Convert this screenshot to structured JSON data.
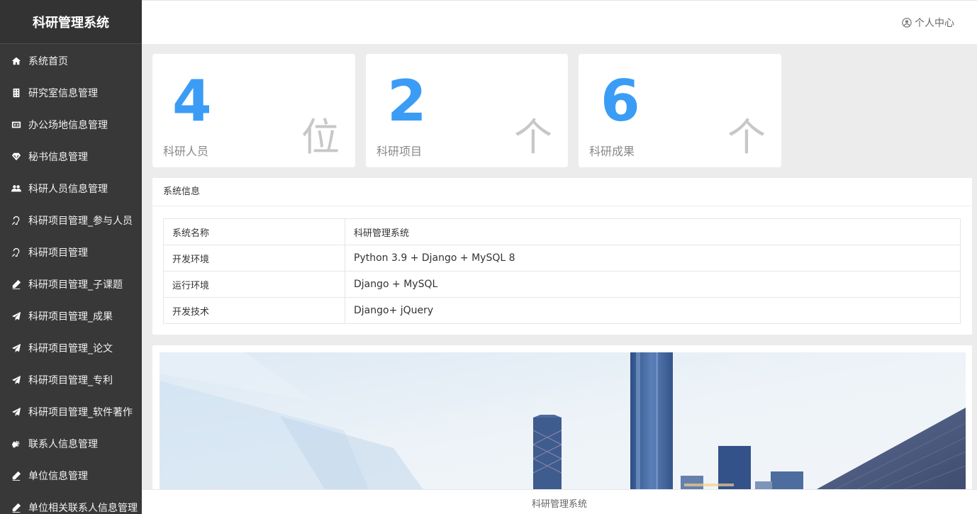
{
  "app": {
    "title": "科研管理系统"
  },
  "sidebar": {
    "items": [
      {
        "label": "系统首页",
        "icon": "home-icon"
      },
      {
        "label": "研究室信息管理",
        "icon": "building-icon"
      },
      {
        "label": "办公场地信息管理",
        "icon": "cc-icon"
      },
      {
        "label": "秘书信息管理",
        "icon": "diamond-icon"
      },
      {
        "label": "科研人员信息管理",
        "icon": "users-icon"
      },
      {
        "label": "科研项目管理_参与人员",
        "icon": "hearing-icon"
      },
      {
        "label": "科研项目管理",
        "icon": "hearing-icon"
      },
      {
        "label": "科研项目管理_子课题",
        "icon": "pencil-icon"
      },
      {
        "label": "科研项目管理_成果",
        "icon": "paper-plane-icon"
      },
      {
        "label": "科研项目管理_论文",
        "icon": "paper-plane-icon"
      },
      {
        "label": "科研项目管理_专利",
        "icon": "paper-plane-icon"
      },
      {
        "label": "科研项目管理_软件著作",
        "icon": "paper-plane-icon"
      },
      {
        "label": "联系人信息管理",
        "icon": "sign-language-icon"
      },
      {
        "label": "单位信息管理",
        "icon": "pencil-icon"
      },
      {
        "label": "单位相关联系人信息管理",
        "icon": "pencil-icon"
      }
    ]
  },
  "header": {
    "user_center": "个人中心"
  },
  "stats": [
    {
      "value": "4",
      "label": "科研人员",
      "unit": "位"
    },
    {
      "value": "2",
      "label": "科研项目",
      "unit": "个"
    },
    {
      "value": "6",
      "label": "科研成果",
      "unit": "个"
    }
  ],
  "system_info": {
    "title": "系统信息",
    "rows": [
      {
        "key": "系统名称",
        "value": "科研管理系统"
      },
      {
        "key": "开发环境",
        "value": "Python 3.9 + Django + MySQL 8"
      },
      {
        "key": "运行环境",
        "value": "Django + MySQL"
      },
      {
        "key": "开发技术",
        "value": "Django+ jQuery"
      }
    ]
  },
  "footer": {
    "text": "科研管理系统"
  },
  "colors": {
    "accent": "#3b9cf6",
    "sidebar_bg": "#383838"
  }
}
